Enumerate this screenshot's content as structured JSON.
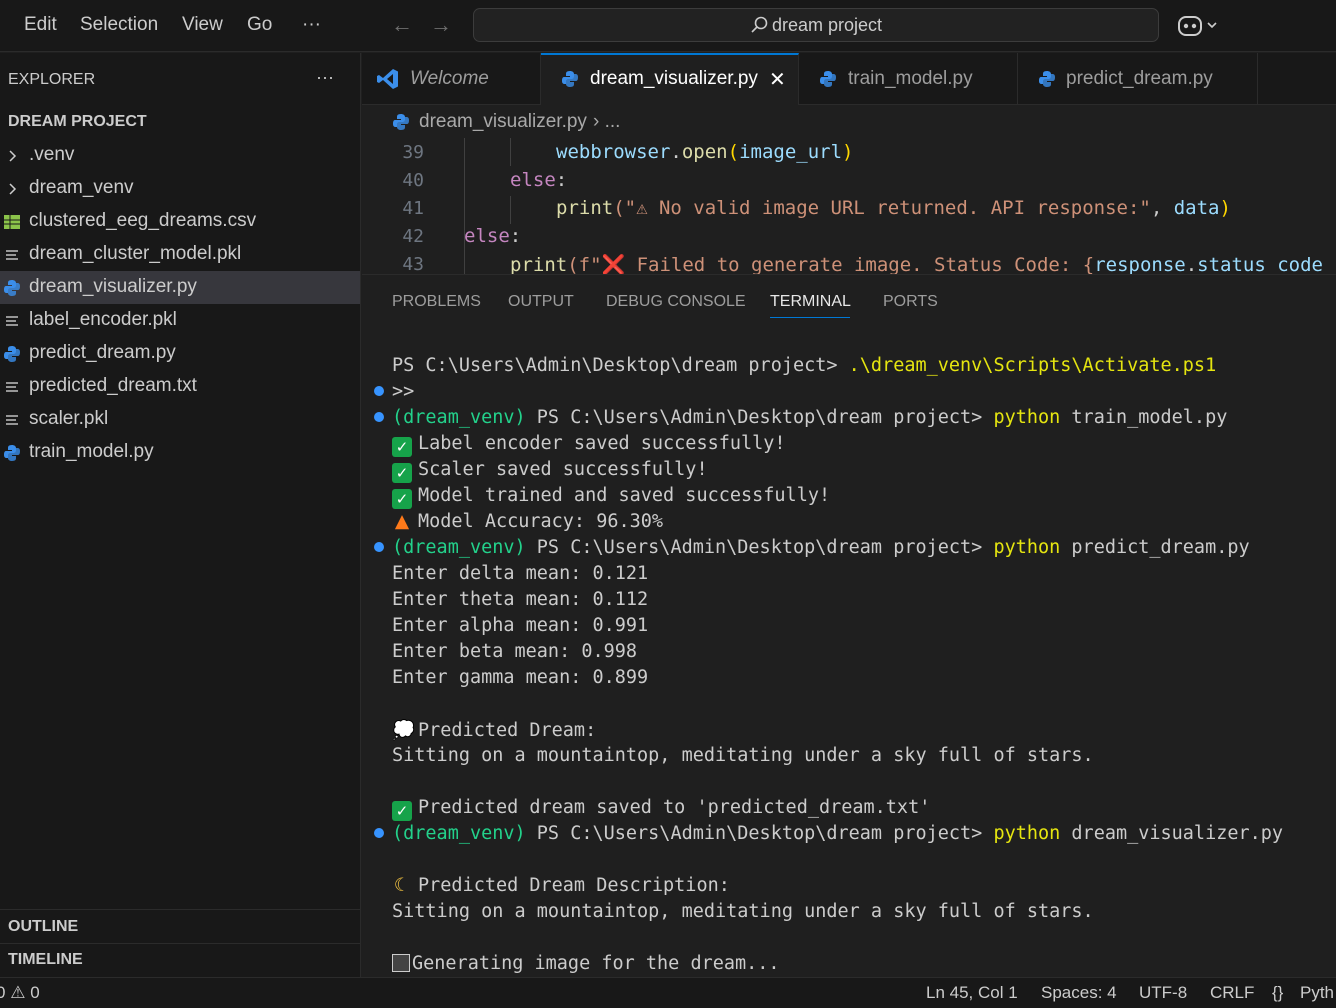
{
  "menu": {
    "edit": "Edit",
    "selection": "Selection",
    "view": "View",
    "go": "Go",
    "more": "···"
  },
  "search": {
    "text": "dream project"
  },
  "sidebar": {
    "title": "EXPLORER",
    "more": "···",
    "project": "DREAM PROJECT",
    "items": [
      {
        "label": ".venv",
        "icon": "chevron-right-icon"
      },
      {
        "label": "dream_venv",
        "icon": "chevron-right-icon"
      },
      {
        "label": "clustered_eeg_dreams.csv",
        "icon": "csv-file-icon"
      },
      {
        "label": "dream_cluster_model.pkl",
        "icon": "text-file-icon"
      },
      {
        "label": "dream_visualizer.py",
        "icon": "python-file-icon"
      },
      {
        "label": "label_encoder.pkl",
        "icon": "text-file-icon"
      },
      {
        "label": "predict_dream.py",
        "icon": "python-file-icon"
      },
      {
        "label": "predicted_dream.txt",
        "icon": "text-file-icon"
      },
      {
        "label": "scaler.pkl",
        "icon": "text-file-icon"
      },
      {
        "label": "train_model.py",
        "icon": "python-file-icon"
      }
    ],
    "outline": "OUTLINE",
    "timeline": "TIMELINE"
  },
  "tabs": [
    {
      "label": "Welcome"
    },
    {
      "label": "dream_visualizer.py",
      "close": "✕"
    },
    {
      "label": "train_model.py"
    },
    {
      "label": "predict_dream.py"
    }
  ],
  "breadcrumb": {
    "file": "dream_visualizer.py",
    "rest": "› ..."
  },
  "editor": {
    "lines": [
      {
        "n": "39",
        "a": "webbrowser",
        "b": ".",
        "c": "open",
        "d": "(",
        "e": "image_url",
        "f": ")"
      },
      {
        "n": "40",
        "kw": "else",
        "p": ":"
      },
      {
        "n": "41",
        "fn": "print",
        "s": "(\"⚠ No valid image URL returned. API response:\"",
        "m": ", ",
        "v": "data",
        "e": ")"
      },
      {
        "n": "42",
        "kw": "else",
        "p": ":"
      },
      {
        "n": "43",
        "fn": "print",
        "s": "(f\"❌ Failed to generate image. Status Code: {",
        "v": "response",
        "m": ".",
        "v2": "status_code"
      }
    ]
  },
  "panel": {
    "tabs": [
      "PROBLEMS",
      "OUTPUT",
      "DEBUG CONSOLE",
      "TERMINAL",
      "PORTS"
    ],
    "terminal": {
      "l1_ps": "PS C:\\Users\\Admin\\Desktop\\dream project> ",
      "l1_cmd": ".\\dream_venv\\Scripts\\Activate.ps1",
      "l2": ">>",
      "env": "(dream_venv)",
      "ps": " PS C:\\Users\\Admin\\Desktop\\dream project> ",
      "py": "python",
      "cmd1": " train_model.py",
      "ok1": "Label encoder saved successfully!",
      "ok2": "Scaler saved successfully!",
      "ok3": "Model trained and saved successfully!",
      "acc": "Model Accuracy: 96.30%",
      "cmd2": " predict_dream.py",
      "in1": "Enter delta mean: 0.121",
      "in2": "Enter theta mean: 0.112",
      "in3": "Enter alpha mean: 0.991",
      "in4": "Enter beta mean: 0.998",
      "in5": "Enter gamma mean: 0.899",
      "pred_h": "Predicted Dream:",
      "pred_t": "Sitting on a mountaintop, meditating under a sky full of stars.",
      "saved": "Predicted dream saved to 'predicted_dream.txt'",
      "cmd3": " dream_visualizer.py",
      "desc_h": "Predicted Dream Description:",
      "desc_t": "Sitting on a mountaintop, meditating under a sky full of stars.",
      "gen": "Generating image for the dream..."
    }
  },
  "statusbar": {
    "errors": "0",
    "warnings": "0",
    "position": "Ln 45, Col 1",
    "spaces": "Spaces: 4",
    "encoding": "UTF-8",
    "eol": "CRLF",
    "braces": "{}",
    "lang": "Pyth"
  },
  "colors": {
    "accent": "#0078d4",
    "python": "#3b8eea",
    "csv": "#8bc34a",
    "keyword": "#c586c0",
    "function": "#dcdcaa",
    "string": "#ce9178",
    "variable": "#9cdcfe",
    "env": "#23d18b",
    "command": "#e5e510",
    "check": "#16a34a"
  }
}
